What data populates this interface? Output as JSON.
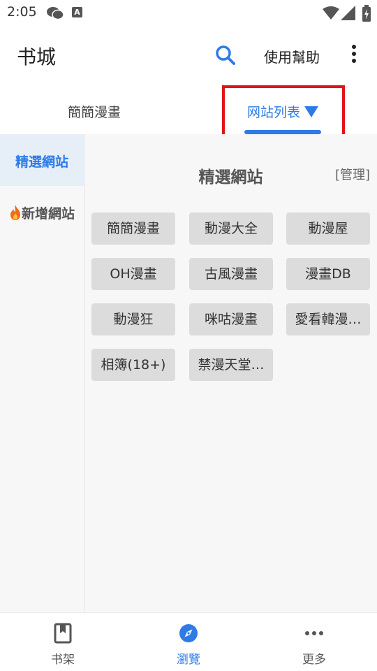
{
  "status_bar": {
    "time": "2:05"
  },
  "app_bar": {
    "title": "书城",
    "help_label": "使用幫助"
  },
  "tabs": [
    {
      "label": "簡簡漫畫"
    },
    {
      "label": "网站列表"
    }
  ],
  "sidebar": {
    "items": [
      {
        "label": "精選網站"
      },
      {
        "label": "新增網站"
      }
    ]
  },
  "content": {
    "title": "精選網站",
    "manage_label": "[管理]",
    "sites": [
      "簡簡漫畫",
      "動漫大全",
      "動漫屋",
      "OH漫畫",
      "古風漫畫",
      "漫畫DB",
      "動漫狂",
      "咪咕漫畫",
      "愛看韓漫…",
      "相簿(18+)",
      "禁漫天堂…"
    ]
  },
  "bottom_nav": {
    "items": [
      {
        "label": "书架",
        "icon": "bookmark-book-icon"
      },
      {
        "label": "瀏覽",
        "icon": "compass-icon"
      },
      {
        "label": "更多",
        "icon": "more-horiz-icon"
      }
    ]
  },
  "colors": {
    "accent": "#2f7be6",
    "highlight": "#e0141a",
    "chip_bg": "#dcdcdc"
  }
}
